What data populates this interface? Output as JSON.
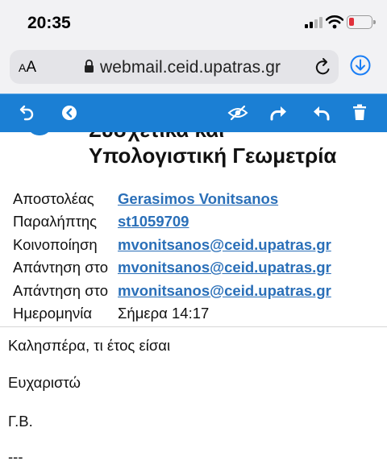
{
  "status_bar": {
    "time": "20:35"
  },
  "browser": {
    "aa_label": "AA",
    "url": "webmail.ceid.upatras.gr"
  },
  "toolbar": {
    "icons": [
      "back-icon",
      "previous-icon",
      "hide-icon",
      "forward-icon",
      "reply-icon",
      "delete-icon"
    ],
    "accent_color": "#1b7fd4"
  },
  "message": {
    "subject_line1": "Συσχετικά και",
    "subject_line2": "Υπολογιστική Γεωμετρία",
    "headers": [
      {
        "label": "Αποστολέας",
        "value": "Gerasimos Vonitsanos",
        "is_link": true
      },
      {
        "label": "Παραλήπτης",
        "value": "st1059709",
        "is_link": true
      },
      {
        "label": "Κοινοποίηση",
        "value": "mvonitsanos@ceid.upatras.gr",
        "is_link": true
      },
      {
        "label": "Απάντηση στο",
        "value": "mvonitsanos@ceid.upatras.gr",
        "is_link": true
      },
      {
        "label": "Απάντηση στο",
        "value": "mvonitsanos@ceid.upatras.gr",
        "is_link": true
      },
      {
        "label": "Ημερομηνία",
        "value": "Σήμερα 14:17",
        "is_link": false
      }
    ],
    "body": [
      "Καλησπέρα, τι έτος είσαι",
      "Ευχαριστώ",
      "Γ.Β.",
      "---"
    ],
    "link_color": "#2a6fb8"
  }
}
